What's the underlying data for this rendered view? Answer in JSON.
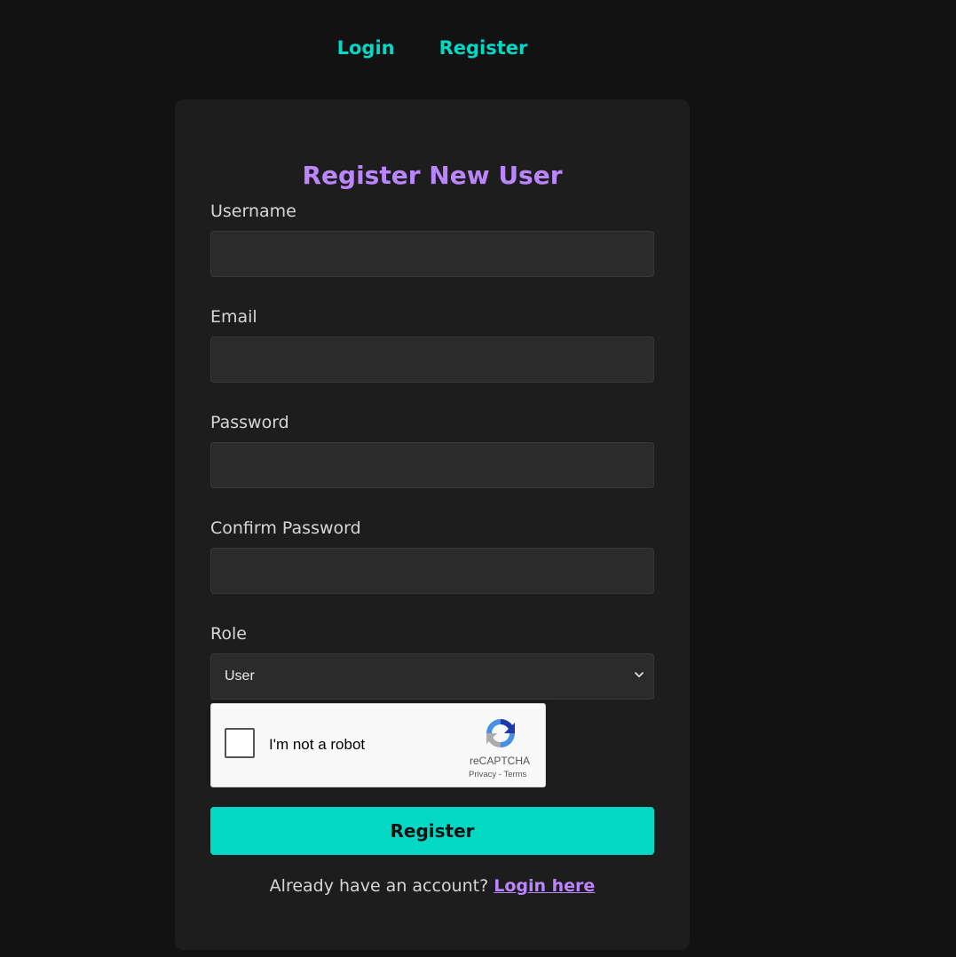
{
  "nav": {
    "login": "Login",
    "register": "Register"
  },
  "form": {
    "title": "Register New User",
    "fields": [
      {
        "label": "Username",
        "value": "",
        "placeholder": ""
      },
      {
        "label": "Email",
        "value": "",
        "placeholder": ""
      },
      {
        "label": "Password",
        "value": "",
        "placeholder": ""
      },
      {
        "label": "Confirm Password",
        "value": "",
        "placeholder": ""
      }
    ],
    "role": {
      "label": "Role",
      "selected": "User"
    },
    "captcha": {
      "text": "I'm not a robot",
      "brand": "reCAPTCHA",
      "privacy": "Privacy",
      "separator": "-",
      "terms": "Terms"
    },
    "submit_label": "Register",
    "footer": {
      "prompt": "Already have an account?",
      "link": "Login here"
    }
  },
  "colors": {
    "background": "#121212",
    "card": "#1d1d1d",
    "accent_teal": "#03d8c4",
    "accent_purple": "#bb86fc"
  },
  "icons": {
    "role_dropdown": "chevron-down-icon",
    "captcha_logo": "recaptcha-logo-icon"
  }
}
